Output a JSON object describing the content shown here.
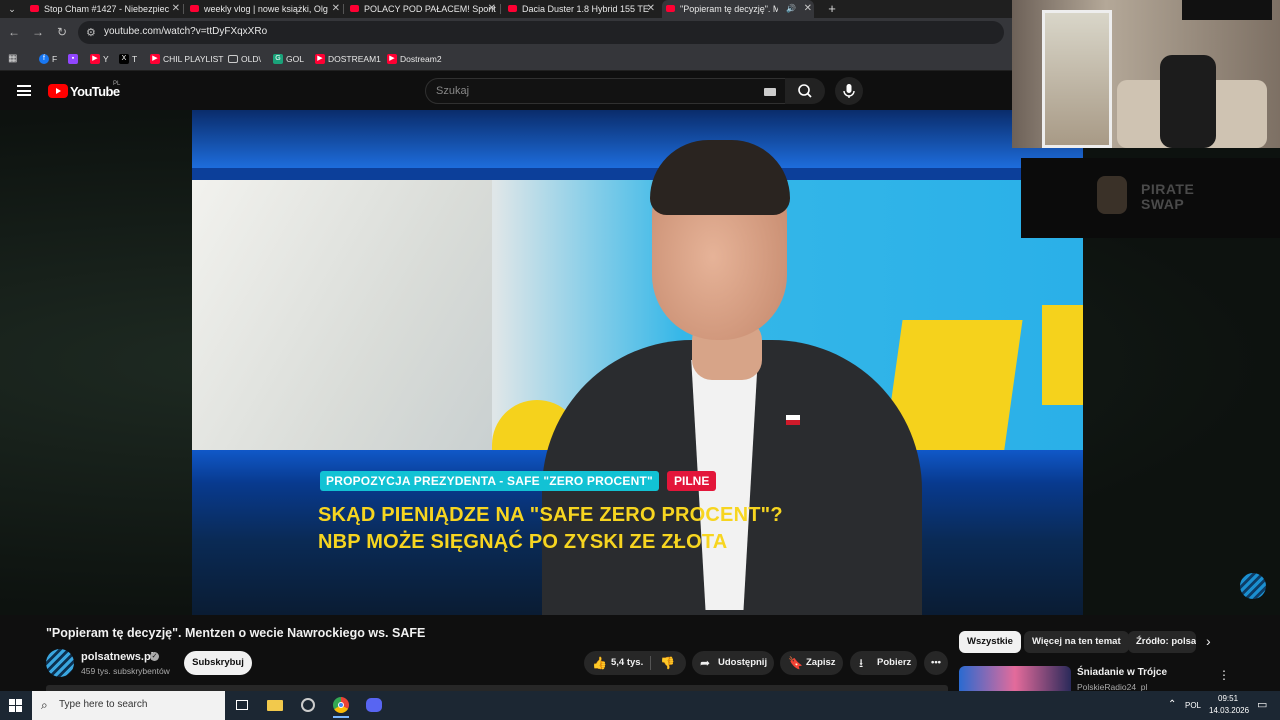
{
  "browser": {
    "tabs": [
      {
        "title": "Stop Cham #1427 - Niebezpiec",
        "active": false
      },
      {
        "title": "weekly vlog | nowe książki, Olg",
        "active": false
      },
      {
        "title": "POLACY POD PAŁACEM! Spont",
        "active": false
      },
      {
        "title": "Dacia Duster 1.8 Hybrid 155 TE",
        "active": false
      },
      {
        "title": "\"Popieram tę decyzję\". Men",
        "active": true
      }
    ],
    "new_tab_glyph": "+",
    "url": "youtube.com/watch?v=ttDyFXqxXRo",
    "bookmarks": [
      {
        "label": "F",
        "icon": "facebook-icon",
        "color": "#1877f2"
      },
      {
        "label": "",
        "icon": "twitch-icon",
        "color": "#9146ff"
      },
      {
        "label": "Y",
        "icon": "youtube-icon",
        "color": "#ff0033"
      },
      {
        "label": "T",
        "icon": "x-icon",
        "color": "#000000"
      },
      {
        "label": "CHIL PLAYLIST",
        "icon": "youtube-icon",
        "color": "#ff0033"
      },
      {
        "label": "OLD\\",
        "icon": "folder-icon",
        "color": "#35363a"
      },
      {
        "label": "GOL",
        "icon": "gol-icon",
        "color": "#1aa37a"
      },
      {
        "label": "DOSTREAM1",
        "icon": "youtube-icon",
        "color": "#ff0033"
      },
      {
        "label": "Dostream2",
        "icon": "youtube-icon",
        "color": "#ff0033"
      }
    ]
  },
  "youtube": {
    "logo_text": "YouTube",
    "region": "PL",
    "search_placeholder": "Szukaj",
    "video": {
      "chyron_topic": "PROPOZYCJA PREZYDENTA - SAFE \"ZERO PROCENT\"",
      "chyron_badge": "PILNE",
      "headline_line1": "SKĄD PIENIĄDZE NA \"SAFE ZERO PROCENT\"?",
      "headline_line2": "NBP MOŻE SIĘGNĄĆ PO ZYSKI ZE ZŁOTA"
    },
    "title": "\"Popieram tę decyzję\". Mentzen o wecie Nawrockiego ws. SAFE",
    "channel": {
      "name": "polsatnews.pl",
      "subscribers": "459 tys. subskrybentów",
      "subscribe_label": "Subskrybuj"
    },
    "actions": {
      "likes": "5,4 tys.",
      "share": "Udostępnij",
      "save": "Zapisz",
      "download": "Pobierz"
    },
    "chips": [
      "Wszystkie",
      "Więcej na ten temat",
      "Źródło: polsa"
    ],
    "suggestion": {
      "title": "Śniadanie w Trójce",
      "channel": "PolskieRadio24_pl"
    }
  },
  "overlay": {
    "brand_line1": "PIRATE",
    "brand_line2": "SWAP"
  },
  "taskbar": {
    "search_placeholder": "Type here to search",
    "language": "POL",
    "time": "09:51",
    "date": "14.03.2026"
  }
}
